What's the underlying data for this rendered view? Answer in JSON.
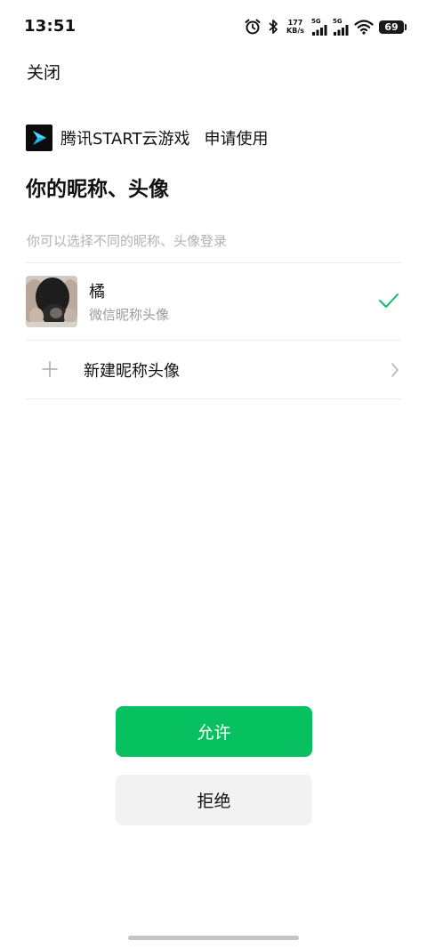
{
  "status_bar": {
    "time": "13:51",
    "net_speed_value": "177",
    "net_speed_unit": "KB/s",
    "signal_1_label": "5G",
    "signal_2_label": "5G",
    "battery_level": "69",
    "icons": [
      "alarm-icon",
      "bluetooth-icon",
      "signal-icon",
      "signal-icon",
      "wifi-icon",
      "battery-icon"
    ]
  },
  "header": {
    "close_label": "关闭"
  },
  "app": {
    "name": "腾讯START云游戏",
    "request_label": "申请使用",
    "logo_icon": "start-logo-icon",
    "logo_accent_color": "#1fb6f2"
  },
  "page": {
    "title": "你的昵称、头像",
    "subtitle": "你可以选择不同的昵称、头像登录"
  },
  "profiles": [
    {
      "name": "橘",
      "description": "微信昵称头像",
      "selected": true,
      "icon": "check-icon"
    }
  ],
  "new_profile": {
    "label": "新建昵称头像",
    "icons": [
      "plus-icon",
      "chevron-right-icon"
    ]
  },
  "actions": {
    "allow_label": "允许",
    "deny_label": "拒绝"
  },
  "colors": {
    "accent": "#07c160",
    "secondary_button": "#f2f2f2",
    "hint_text": "#b2b2b2"
  }
}
